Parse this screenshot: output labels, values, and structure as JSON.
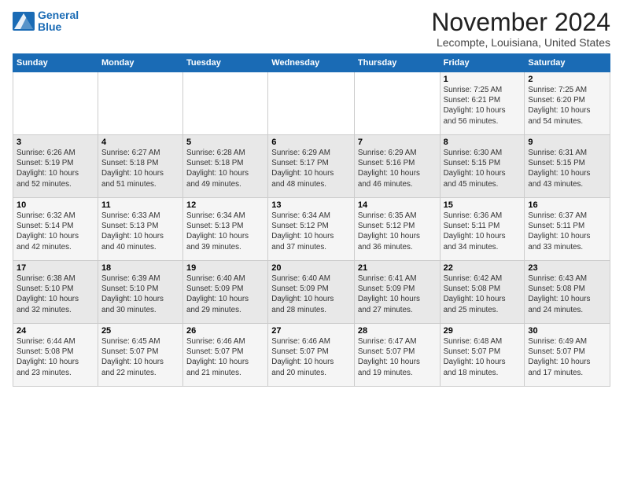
{
  "logo": {
    "line1": "General",
    "line2": "Blue"
  },
  "title": "November 2024",
  "subtitle": "Lecompte, Louisiana, United States",
  "header_days": [
    "Sunday",
    "Monday",
    "Tuesday",
    "Wednesday",
    "Thursday",
    "Friday",
    "Saturday"
  ],
  "weeks": [
    [
      {
        "day": "",
        "info": ""
      },
      {
        "day": "",
        "info": ""
      },
      {
        "day": "",
        "info": ""
      },
      {
        "day": "",
        "info": ""
      },
      {
        "day": "",
        "info": ""
      },
      {
        "day": "1",
        "info": "Sunrise: 7:25 AM\nSunset: 6:21 PM\nDaylight: 10 hours\nand 56 minutes."
      },
      {
        "day": "2",
        "info": "Sunrise: 7:25 AM\nSunset: 6:20 PM\nDaylight: 10 hours\nand 54 minutes."
      }
    ],
    [
      {
        "day": "3",
        "info": "Sunrise: 6:26 AM\nSunset: 5:19 PM\nDaylight: 10 hours\nand 52 minutes."
      },
      {
        "day": "4",
        "info": "Sunrise: 6:27 AM\nSunset: 5:18 PM\nDaylight: 10 hours\nand 51 minutes."
      },
      {
        "day": "5",
        "info": "Sunrise: 6:28 AM\nSunset: 5:18 PM\nDaylight: 10 hours\nand 49 minutes."
      },
      {
        "day": "6",
        "info": "Sunrise: 6:29 AM\nSunset: 5:17 PM\nDaylight: 10 hours\nand 48 minutes."
      },
      {
        "day": "7",
        "info": "Sunrise: 6:29 AM\nSunset: 5:16 PM\nDaylight: 10 hours\nand 46 minutes."
      },
      {
        "day": "8",
        "info": "Sunrise: 6:30 AM\nSunset: 5:15 PM\nDaylight: 10 hours\nand 45 minutes."
      },
      {
        "day": "9",
        "info": "Sunrise: 6:31 AM\nSunset: 5:15 PM\nDaylight: 10 hours\nand 43 minutes."
      }
    ],
    [
      {
        "day": "10",
        "info": "Sunrise: 6:32 AM\nSunset: 5:14 PM\nDaylight: 10 hours\nand 42 minutes."
      },
      {
        "day": "11",
        "info": "Sunrise: 6:33 AM\nSunset: 5:13 PM\nDaylight: 10 hours\nand 40 minutes."
      },
      {
        "day": "12",
        "info": "Sunrise: 6:34 AM\nSunset: 5:13 PM\nDaylight: 10 hours\nand 39 minutes."
      },
      {
        "day": "13",
        "info": "Sunrise: 6:34 AM\nSunset: 5:12 PM\nDaylight: 10 hours\nand 37 minutes."
      },
      {
        "day": "14",
        "info": "Sunrise: 6:35 AM\nSunset: 5:12 PM\nDaylight: 10 hours\nand 36 minutes."
      },
      {
        "day": "15",
        "info": "Sunrise: 6:36 AM\nSunset: 5:11 PM\nDaylight: 10 hours\nand 34 minutes."
      },
      {
        "day": "16",
        "info": "Sunrise: 6:37 AM\nSunset: 5:11 PM\nDaylight: 10 hours\nand 33 minutes."
      }
    ],
    [
      {
        "day": "17",
        "info": "Sunrise: 6:38 AM\nSunset: 5:10 PM\nDaylight: 10 hours\nand 32 minutes."
      },
      {
        "day": "18",
        "info": "Sunrise: 6:39 AM\nSunset: 5:10 PM\nDaylight: 10 hours\nand 30 minutes."
      },
      {
        "day": "19",
        "info": "Sunrise: 6:40 AM\nSunset: 5:09 PM\nDaylight: 10 hours\nand 29 minutes."
      },
      {
        "day": "20",
        "info": "Sunrise: 6:40 AM\nSunset: 5:09 PM\nDaylight: 10 hours\nand 28 minutes."
      },
      {
        "day": "21",
        "info": "Sunrise: 6:41 AM\nSunset: 5:09 PM\nDaylight: 10 hours\nand 27 minutes."
      },
      {
        "day": "22",
        "info": "Sunrise: 6:42 AM\nSunset: 5:08 PM\nDaylight: 10 hours\nand 25 minutes."
      },
      {
        "day": "23",
        "info": "Sunrise: 6:43 AM\nSunset: 5:08 PM\nDaylight: 10 hours\nand 24 minutes."
      }
    ],
    [
      {
        "day": "24",
        "info": "Sunrise: 6:44 AM\nSunset: 5:08 PM\nDaylight: 10 hours\nand 23 minutes."
      },
      {
        "day": "25",
        "info": "Sunrise: 6:45 AM\nSunset: 5:07 PM\nDaylight: 10 hours\nand 22 minutes."
      },
      {
        "day": "26",
        "info": "Sunrise: 6:46 AM\nSunset: 5:07 PM\nDaylight: 10 hours\nand 21 minutes."
      },
      {
        "day": "27",
        "info": "Sunrise: 6:46 AM\nSunset: 5:07 PM\nDaylight: 10 hours\nand 20 minutes."
      },
      {
        "day": "28",
        "info": "Sunrise: 6:47 AM\nSunset: 5:07 PM\nDaylight: 10 hours\nand 19 minutes."
      },
      {
        "day": "29",
        "info": "Sunrise: 6:48 AM\nSunset: 5:07 PM\nDaylight: 10 hours\nand 18 minutes."
      },
      {
        "day": "30",
        "info": "Sunrise: 6:49 AM\nSunset: 5:07 PM\nDaylight: 10 hours\nand 17 minutes."
      }
    ]
  ]
}
